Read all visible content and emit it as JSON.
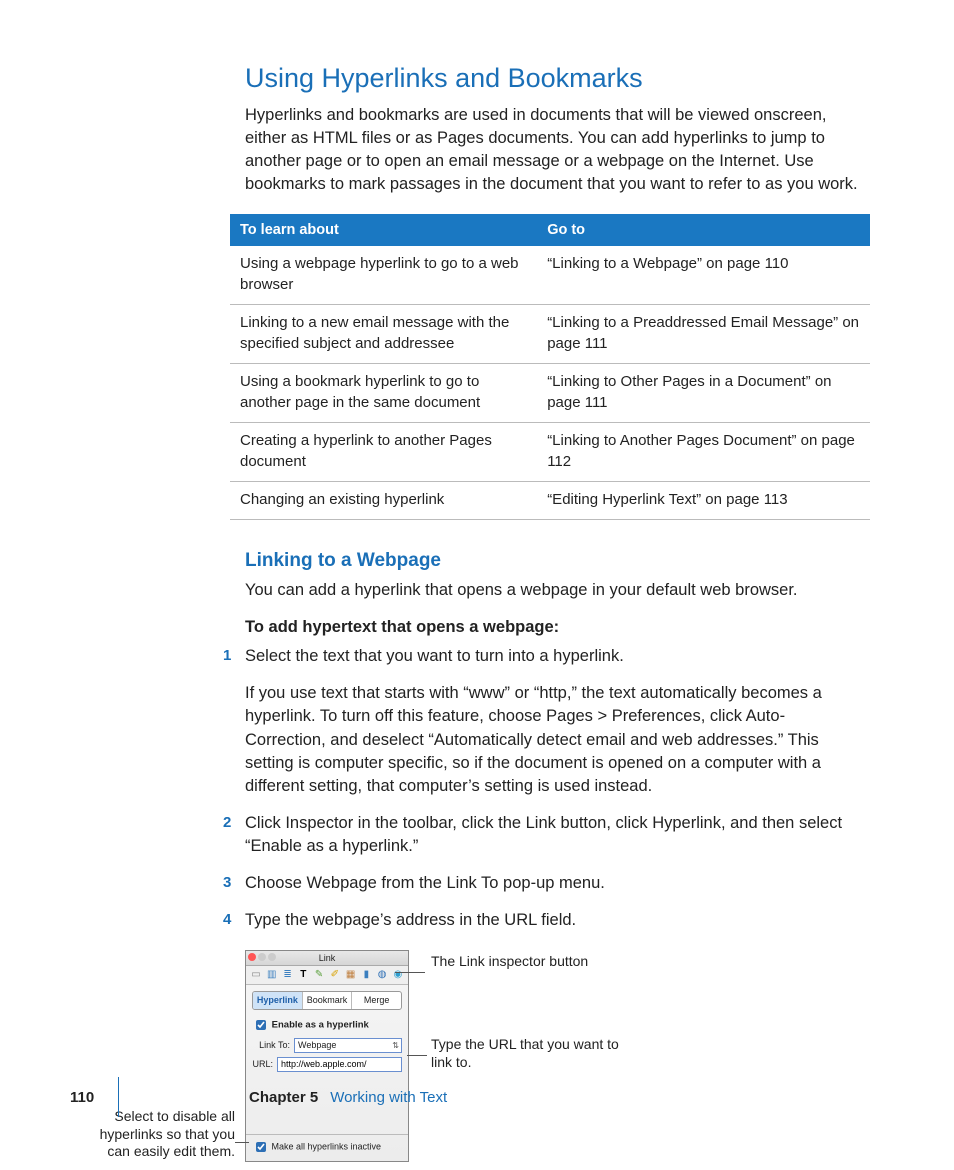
{
  "h1": "Using Hyperlinks and Bookmarks",
  "intro": "Hyperlinks and bookmarks are used in documents that will be viewed onscreen, either as HTML files or as Pages documents. You can add hyperlinks to jump to another page or to open an email message or a webpage on the Internet. Use bookmarks to mark passages in the document that you want to refer to as you work.",
  "table": {
    "head": {
      "c1": "To learn about",
      "c2": "Go to"
    },
    "rows": [
      {
        "c1": "Using a webpage hyperlink to go to a web browser",
        "c2": "“Linking to a Webpage” on page 110"
      },
      {
        "c1": "Linking to a new email message with the specified subject and addressee",
        "c2": "“Linking to a Preaddressed Email Message” on page 111"
      },
      {
        "c1": "Using a bookmark hyperlink to go to another page in the same document",
        "c2": "“Linking to Other Pages in a Document” on page 111"
      },
      {
        "c1": "Creating a hyperlink to another Pages document",
        "c2": "“Linking to Another Pages Document” on page 112"
      },
      {
        "c1": "Changing an existing hyperlink",
        "c2": "“Editing Hyperlink Text” on page 113"
      }
    ]
  },
  "h2": "Linking to a Webpage",
  "sub_intro": "You can add a hyperlink that opens a webpage in your default web browser.",
  "howto_head": "To add hypertext that opens a webpage:",
  "steps": [
    {
      "n": "1",
      "t": "Select the text that you want to turn into a hyperlink.",
      "extra": "If you use text that starts with “www” or “http,” the text automatically becomes a hyperlink. To turn off this feature, choose Pages > Preferences, click Auto-Correction, and deselect “Automatically detect email and web addresses.” This setting is computer specific, so if the document is opened on a computer with a different setting, that computer’s setting is used instead."
    },
    {
      "n": "2",
      "t": "Click Inspector in the toolbar, click the Link button, click Hyperlink, and then select “Enable as a hyperlink.”"
    },
    {
      "n": "3",
      "t": "Choose Webpage from the Link To pop-up menu."
    },
    {
      "n": "4",
      "t": "Type the webpage’s address in the URL field."
    }
  ],
  "inspector": {
    "title": "Link",
    "tabs": {
      "a": "Hyperlink",
      "b": "Bookmark",
      "c": "Merge"
    },
    "enable": "Enable as a hyperlink",
    "linkto_label": "Link To:",
    "linkto_value": "Webpage",
    "url_label": "URL:",
    "url_value": "http://web.apple.com/",
    "inactive": "Make all hyperlinks inactive"
  },
  "callouts": {
    "top": "The Link inspector button",
    "mid": "Type the URL that you want to link to.",
    "left": "Select to disable all hyperlinks so that you can easily edit them."
  },
  "footer": {
    "page": "110",
    "chapter": "Chapter 5",
    "title": "Working with Text"
  }
}
